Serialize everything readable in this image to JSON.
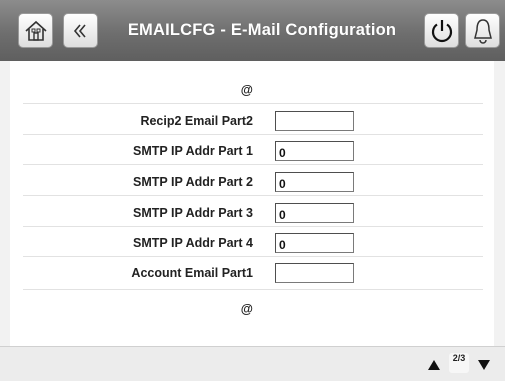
{
  "header": {
    "title": "EMAILCFG - E-Mail Configuration",
    "icons": [
      "home-icon",
      "back-icon",
      "power-icon",
      "alarm-bell-icon"
    ]
  },
  "rows": {
    "at_top": "@",
    "recip2": {
      "label": "Recip2 Email Part2",
      "value": ""
    },
    "smtp1": {
      "label": "SMTP IP Addr Part 1",
      "value": "0"
    },
    "smtp2": {
      "label": "SMTP IP Addr Part 2",
      "value": "0"
    },
    "smtp3": {
      "label": "SMTP IP Addr Part 3",
      "value": "0"
    },
    "smtp4": {
      "label": "SMTP IP Addr Part 4",
      "value": "0"
    },
    "account1": {
      "label": "Account Email Part1",
      "value": ""
    },
    "at_bottom": "@"
  },
  "footer": {
    "page": "2/3"
  },
  "colors": {
    "header_gradient_top": "#8c8c8c",
    "header_gradient_bottom": "#5f5f5f",
    "panel": "#ffffff",
    "background": "#f2f2f2"
  }
}
